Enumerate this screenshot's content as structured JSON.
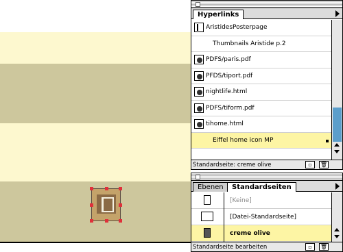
{
  "hyperlinks_panel": {
    "tab_label": "Hyperlinks",
    "items": [
      {
        "label": "AristidesPosterpage",
        "icon": "anchor-icon",
        "indented": false,
        "highlighted": false
      },
      {
        "label": "Thumbnails Aristide p.2",
        "icon": "",
        "indented": true,
        "highlighted": false
      },
      {
        "label": "PDFS/paris.pdf",
        "icon": "globe-link-icon",
        "indented": false,
        "highlighted": false
      },
      {
        "label": "PFDS/tiport.pdf",
        "icon": "globe-link-icon",
        "indented": false,
        "highlighted": false
      },
      {
        "label": "nightlife.html",
        "icon": "globe-link-icon",
        "indented": false,
        "highlighted": false
      },
      {
        "label": "PDFS/tiform.pdf",
        "icon": "globe-link-icon",
        "indented": false,
        "highlighted": false
      },
      {
        "label": "tihome.html",
        "icon": "globe-link-icon",
        "indented": false,
        "highlighted": false
      },
      {
        "label": "Eiffel home icon MP",
        "icon": "",
        "indented": true,
        "highlighted": true
      }
    ],
    "status_text": "Standardseite: creme olive",
    "highlight_color": "#fdf5a4"
  },
  "master_pages_panel": {
    "tabs": [
      "Ebenen",
      "Standardseiten"
    ],
    "active_tab": "Standardseiten",
    "items": [
      {
        "label": "[Keine]",
        "icon": "blank-page-icon",
        "dim": true,
        "highlighted": false
      },
      {
        "label": "[Datei-Standardseite]",
        "icon": "double-page-icon",
        "dim": false,
        "highlighted": false
      },
      {
        "label": "creme olive",
        "icon": "filled-page-icon",
        "dim": false,
        "highlighted": true
      }
    ],
    "status_text": "Standardseite bearbeiten"
  },
  "canvas": {
    "colors": {
      "cream": "#fdf8cf",
      "olive": "#cdc79d"
    },
    "selected_object": "eiffel-home-icon"
  }
}
